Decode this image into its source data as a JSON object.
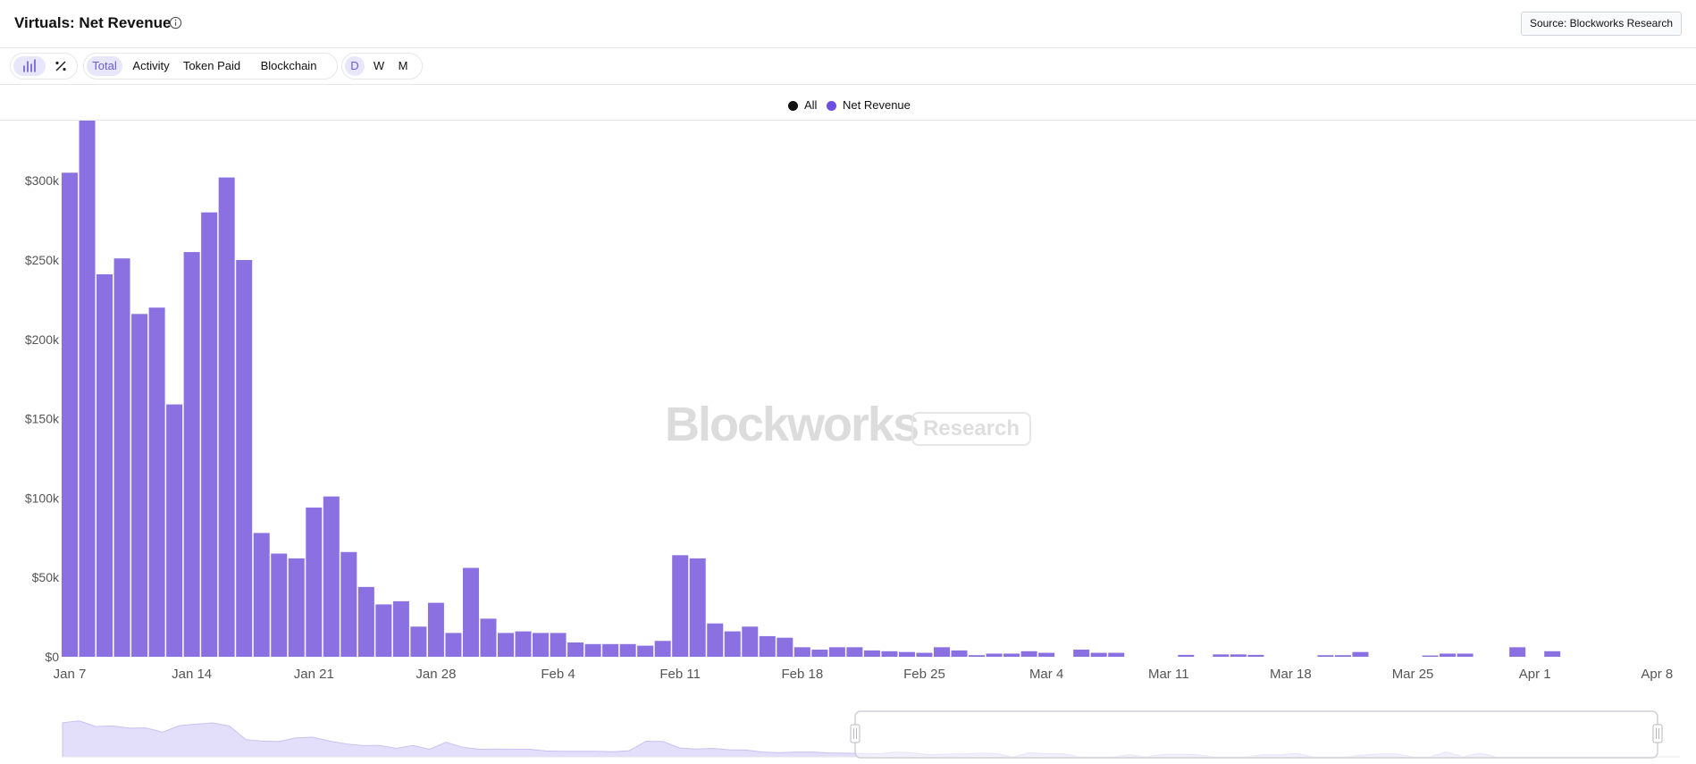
{
  "header": {
    "title": "Virtuals: Net Revenue",
    "source_label": "Source: Blockworks Research"
  },
  "toolbar": {
    "chart_mode_icons": [
      "bar-chart-icon",
      "percent-icon"
    ],
    "metric_tabs": [
      "Total",
      "Activity",
      "Token Paid",
      "Blockchain"
    ],
    "active_metric": "Total",
    "period_tabs": [
      "D",
      "W",
      "M"
    ],
    "active_period": "D"
  },
  "legend": [
    {
      "label": "All",
      "color": "#111111"
    },
    {
      "label": "Net Revenue",
      "color": "#6d4ee0"
    }
  ],
  "watermark": {
    "brand": "Blockworks",
    "tag": "Research"
  },
  "colors": {
    "bar": "#8a70e0",
    "accent": "#6d5bd0",
    "nav_fill": "#e3defa"
  },
  "chart_data": {
    "type": "bar",
    "title": "Virtuals: Net Revenue",
    "xlabel": "",
    "ylabel": "",
    "start_date": "Jan 7",
    "x_ticks": [
      "Jan 7",
      "Jan 14",
      "Jan 21",
      "Jan 28",
      "Feb 4",
      "Feb 11",
      "Feb 18",
      "Feb 25",
      "Mar 4",
      "Mar 11",
      "Mar 18",
      "Mar 25",
      "Apr 1",
      "Apr 8"
    ],
    "y_ticks": [
      "$0",
      "$50k",
      "$100k",
      "$150k",
      "$200k",
      "$250k",
      "$300k"
    ],
    "ylim": [
      0,
      335000
    ],
    "grid": false,
    "legend_position": "top-center",
    "series": [
      {
        "name": "Net Revenue",
        "values": [
          305000,
          338000,
          241000,
          251000,
          216000,
          220000,
          159000,
          255000,
          280000,
          302000,
          250000,
          78000,
          65000,
          62000,
          94000,
          101000,
          66000,
          44000,
          33000,
          35000,
          19000,
          34000,
          15000,
          56000,
          24000,
          15000,
          16000,
          15000,
          15000,
          9000,
          8000,
          8000,
          8000,
          7000,
          10000,
          64000,
          62000,
          21000,
          16000,
          19000,
          13000,
          12000,
          6000,
          4500,
          6000,
          6000,
          4000,
          3500,
          3000,
          2500,
          6000,
          4000,
          1000,
          2000,
          2000,
          3500,
          2500,
          0,
          4500,
          2500,
          2500,
          0,
          0,
          0,
          1200,
          0,
          1500,
          1500,
          1200,
          0,
          0,
          0,
          1000,
          1000,
          3000,
          0,
          0,
          0,
          800,
          2000,
          2000,
          0,
          0,
          6000,
          0,
          3500,
          0,
          0,
          0,
          0,
          0,
          0,
          0,
          0,
          0,
          0,
          0,
          0
        ]
      }
    ]
  }
}
